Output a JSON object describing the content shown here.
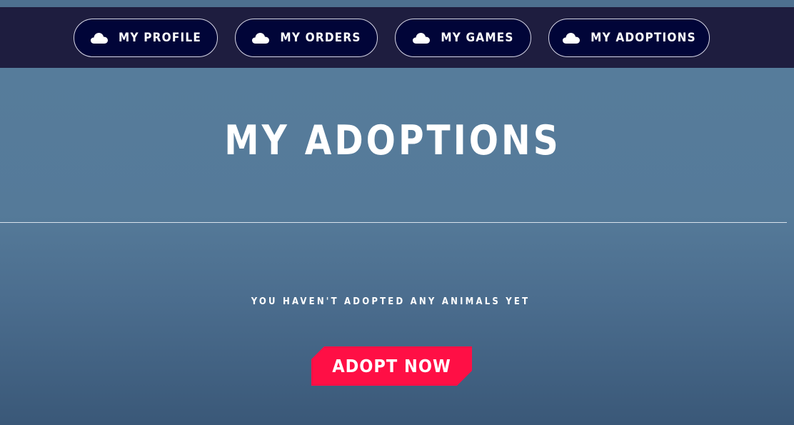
{
  "nav": {
    "items": [
      {
        "label": "MY PROFILE",
        "icon": "cloud-icon"
      },
      {
        "label": "MY ORDERS",
        "icon": "cloud-icon"
      },
      {
        "label": "MY GAMES",
        "icon": "cloud-icon"
      },
      {
        "label": "MY ADOPTIONS",
        "icon": "cloud-icon"
      }
    ]
  },
  "main": {
    "title": "MY ADOPTIONS",
    "empty_message": "YOU HAVEN'T ADOPTED ANY ANIMALS YET",
    "cta_label": "ADOPT NOW"
  },
  "colors": {
    "navbar_bg": "#1e1d3f",
    "button_bg": "#010538",
    "accent": "#ff0f45",
    "page_bg": "#557a99"
  }
}
